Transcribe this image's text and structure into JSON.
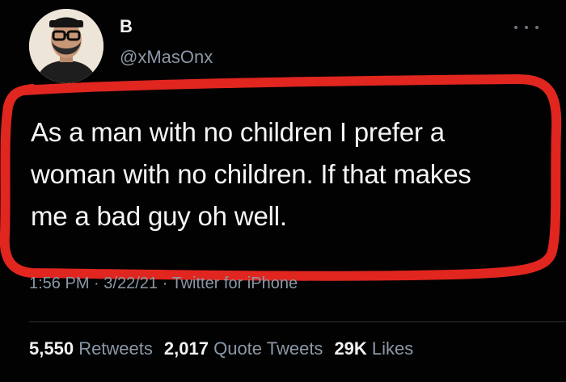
{
  "user": {
    "display_name": "B",
    "handle": "@xMasOnx",
    "avatar_icon": "user-avatar-photo"
  },
  "tweet": {
    "text_lines": [
      "As a man with no children I prefer a",
      "woman with no children. If that makes",
      "me a bad guy oh well."
    ],
    "time": "1:56 PM",
    "date": "3/22/21",
    "separator": "·",
    "source": "Twitter for iPhone"
  },
  "stats": {
    "retweets_count": "5,550",
    "retweets_label": "Retweets",
    "quotes_count": "2,017",
    "quotes_label": "Quote Tweets",
    "likes_count": "29K",
    "likes_label": "Likes"
  },
  "colors": {
    "background": "#000000",
    "text": "#f5f5f5",
    "muted": "#8b98a5",
    "annotation": "#e0261f"
  },
  "icons": {
    "more": "more-horizontal-icon"
  }
}
